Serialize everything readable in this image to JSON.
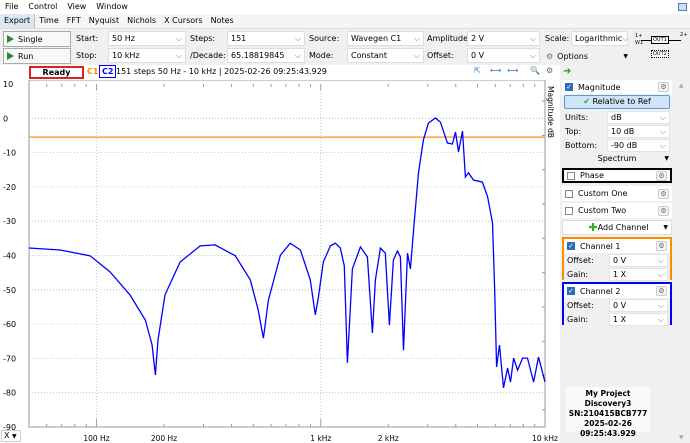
{
  "menu": [
    "File",
    "Control",
    "View",
    "Window"
  ],
  "tabs": [
    "Export",
    "Time",
    "FFT",
    "Nyquist",
    "Nichols",
    "X Cursors",
    "Notes"
  ],
  "controls": {
    "single": "Single",
    "run": "Run",
    "start_label": "Start:",
    "start": "50 Hz",
    "stop_label": "Stop:",
    "stop": "10 kHz",
    "steps_label": "Steps:",
    "steps": "151",
    "decade_label": "/Decade:",
    "decade": "65.18819845",
    "source_label": "Source:",
    "source": "Wavegen C1",
    "mode_label": "Mode:",
    "mode": "Constant",
    "amplitude_label": "Amplitude:",
    "amplitude": "2 V",
    "offset_label": "Offset:",
    "offset": "0 V",
    "scale_label": "Scale:",
    "scale": "Logarithmic",
    "options": "Options",
    "diagram": {
      "in": "1+",
      "w1": "W1",
      "out1": "OUT1",
      "out2": "OUT2",
      "out": "2+"
    }
  },
  "status": {
    "state": "Ready",
    "c1": "C1",
    "c2": "C2",
    "info": "151 steps  50 Hz - 10 kHz | 2025-02-26 09:25:43.929"
  },
  "panel": {
    "magnitude": {
      "label": "Magnitude",
      "relative": "Relative to Ref",
      "units_label": "Units:",
      "units": "dB",
      "top_label": "Top:",
      "top": "10 dB",
      "bottom_label": "Bottom:",
      "bottom": "-90 dB",
      "spectrum": "Spectrum"
    },
    "phase": "Phase",
    "custom_one": "Custom One",
    "custom_two": "Custom Two",
    "add_channel": "Add Channel",
    "channel1": {
      "label": "Channel 1",
      "offset_label": "Offset:",
      "offset": "0 V",
      "gain_label": "Gain:",
      "gain": "1 X",
      "color": "#ff8c00"
    },
    "channel2": {
      "label": "Channel 2",
      "offset_label": "Offset:",
      "offset": "0 V",
      "gain_label": "Gain:",
      "gain": "1 X",
      "color": "#0000ff"
    },
    "info": {
      "project": "My Project",
      "device": "Discovery3",
      "sn": "SN:210415BCB777",
      "time": "2025-02-26 09:25:43.929"
    }
  },
  "axis_selector": "X",
  "chart_data": {
    "type": "line",
    "ylabel": "Magnitude dB",
    "xscale": "log",
    "xlim": [
      50,
      10000
    ],
    "ylim": [
      -90,
      10
    ],
    "yticks": [
      "10",
      "0",
      "-10",
      "-20",
      "-30",
      "-40",
      "-50",
      "-60",
      "-70",
      "-80",
      "-90"
    ],
    "xticks": [
      {
        "v": 100,
        "label": "100 Hz"
      },
      {
        "v": 200,
        "label": "200 Hz"
      },
      {
        "v": 1000,
        "label": "1 kHz"
      },
      {
        "v": 2000,
        "label": "2 kHz"
      },
      {
        "v": 10000,
        "label": "10 kHz"
      }
    ],
    "grid": true,
    "reference_db": -5.5,
    "reference_color": "#ffa040",
    "series": [
      {
        "color": "#0000ff",
        "points": [
          [
            50,
            -37.8
          ],
          [
            68.8,
            -38.4
          ],
          [
            93.6,
            -40.1
          ],
          [
            115,
            -44.8
          ],
          [
            141,
            -51.5
          ],
          [
            165,
            -58.8
          ],
          [
            177,
            -66.1
          ],
          [
            183,
            -74.8
          ],
          [
            188,
            -64.6
          ],
          [
            202,
            -51.5
          ],
          [
            236,
            -41.9
          ],
          [
            290,
            -37.2
          ],
          [
            338,
            -36.9
          ],
          [
            416,
            -40.1
          ],
          [
            485,
            -47.1
          ],
          [
            526,
            -55.9
          ],
          [
            555,
            -64.1
          ],
          [
            584,
            -53.0
          ],
          [
            661,
            -39.9
          ],
          [
            731,
            -36.4
          ],
          [
            811,
            -38.4
          ],
          [
            898,
            -47.1
          ],
          [
            946,
            -57.3
          ],
          [
            975,
            -52.4
          ],
          [
            1027,
            -41.9
          ],
          [
            1104,
            -37.2
          ],
          [
            1161,
            -36.4
          ],
          [
            1222,
            -37.8
          ],
          [
            1274,
            -43.0
          ],
          [
            1315,
            -71.3
          ],
          [
            1384,
            -43.9
          ],
          [
            1503,
            -37.5
          ],
          [
            1615,
            -40.4
          ],
          [
            1699,
            -62.6
          ],
          [
            1753,
            -47.1
          ],
          [
            1845,
            -37.8
          ],
          [
            1941,
            -39.3
          ],
          [
            2023,
            -60.3
          ],
          [
            2109,
            -41.3
          ],
          [
            2198,
            -38.7
          ],
          [
            2266,
            -40.4
          ],
          [
            2338,
            -67.6
          ],
          [
            2436,
            -39.3
          ],
          [
            2510,
            -43.9
          ],
          [
            2617,
            -29.7
          ],
          [
            2728,
            -15.9
          ],
          [
            2870,
            -6.3
          ],
          [
            3021,
            -1.4
          ],
          [
            3246,
            0.1
          ],
          [
            3418,
            -1.1
          ],
          [
            3672,
            -7.2
          ],
          [
            3864,
            -7.5
          ],
          [
            3989,
            -4.0
          ],
          [
            4112,
            -9.8
          ],
          [
            4286,
            -3.7
          ],
          [
            4418,
            -17.1
          ],
          [
            4558,
            -15.9
          ],
          [
            4794,
            -18.0
          ],
          [
            5257,
            -18.6
          ],
          [
            5544,
            -22.9
          ],
          [
            5835,
            -30.5
          ],
          [
            5957,
            -49.2
          ],
          [
            6082,
            -72.5
          ],
          [
            6268,
            -66.1
          ],
          [
            6532,
            -78.6
          ],
          [
            6810,
            -72.8
          ],
          [
            7015,
            -76.9
          ],
          [
            7242,
            -69.9
          ],
          [
            7548,
            -73.4
          ],
          [
            7945,
            -69.9
          ],
          [
            8356,
            -69.9
          ],
          [
            8891,
            -76.9
          ],
          [
            9357,
            -69.6
          ],
          [
            10000,
            -76.9
          ]
        ]
      }
    ]
  }
}
